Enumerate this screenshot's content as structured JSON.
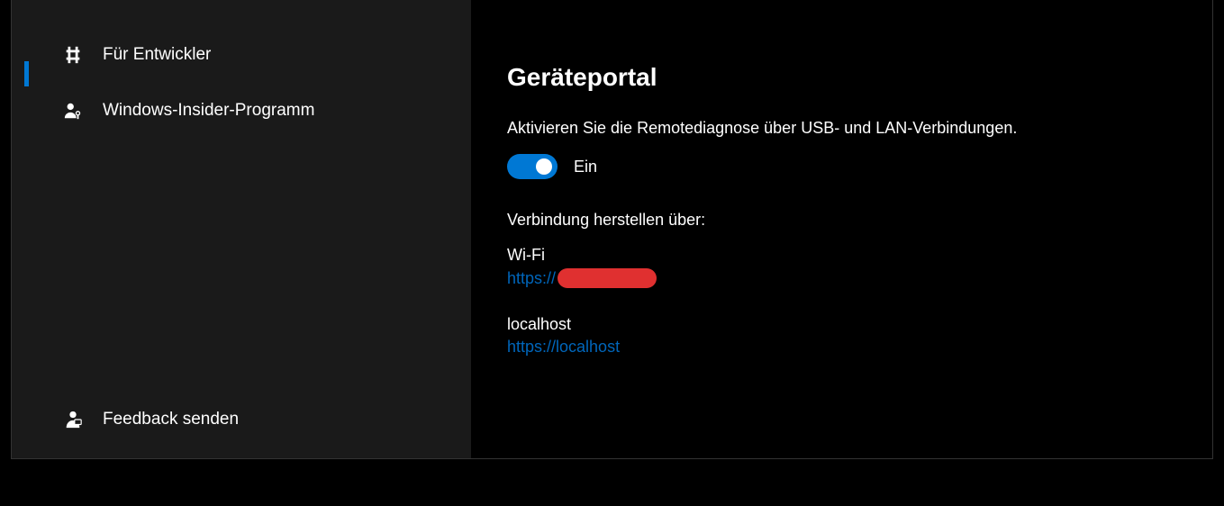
{
  "sidebar": {
    "items": [
      {
        "label": "Für Entwickler"
      },
      {
        "label": "Windows-Insider-Programm"
      }
    ],
    "footer": {
      "label": "Feedback senden"
    }
  },
  "content": {
    "title": "Geräteportal",
    "description": "Aktivieren Sie die Remotediagnose über USB- und LAN-Verbindungen.",
    "toggle": {
      "state": "on",
      "label": "Ein"
    },
    "connect_heading": "Verbindung herstellen über:",
    "connections": [
      {
        "label": "Wi-Fi",
        "link_prefix": "https://",
        "redacted": true
      },
      {
        "label": "localhost",
        "link": "https://localhost"
      }
    ]
  }
}
